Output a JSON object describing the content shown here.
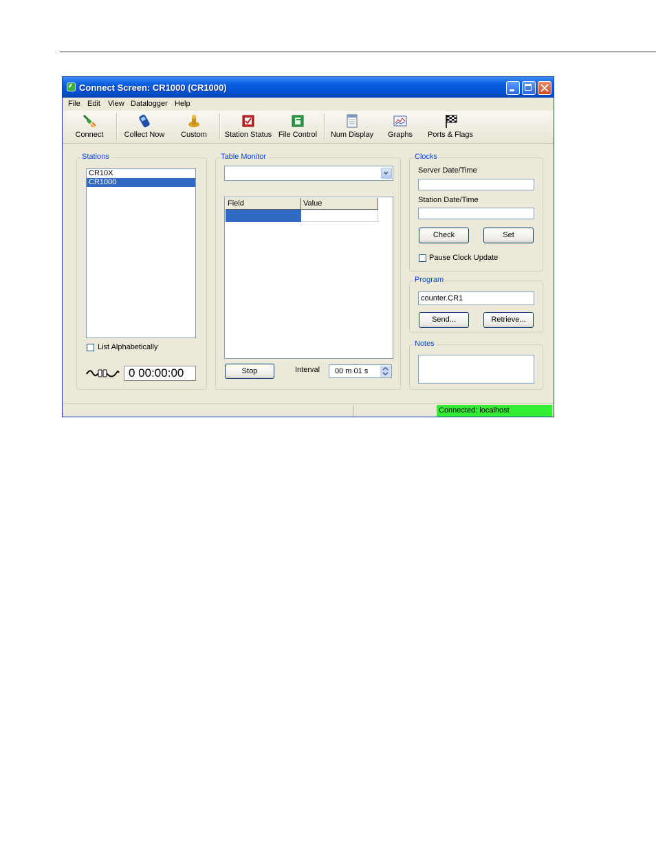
{
  "window": {
    "title": "Connect Screen: CR1000 (CR1000)"
  },
  "menu": [
    "File",
    "Edit",
    "View",
    "Datalogger",
    "Help"
  ],
  "toolbar": {
    "connect": "Connect",
    "collect_now": "Collect Now",
    "custom": "Custom",
    "station_status": "Station Status",
    "file_control": "File Control",
    "num_display": "Num Display",
    "graphs": "Graphs",
    "ports_flags": "Ports & Flags"
  },
  "stations": {
    "legend": "Stations",
    "items": [
      "CR10X",
      "CR1000"
    ],
    "selected": "CR1000",
    "list_alphabetically": "List Alphabetically",
    "timer": "0 00:00:00"
  },
  "table_monitor": {
    "legend": "Table Monitor",
    "dropdown_value": "",
    "columns": [
      "Field",
      "Value"
    ],
    "stop": "Stop",
    "interval_label": "Interval",
    "interval_value": "00 m 01 s"
  },
  "clocks": {
    "legend": "Clocks",
    "server_label": "Server Date/Time",
    "server_value": "",
    "station_label": "Station Date/Time",
    "station_value": "",
    "check": "Check",
    "set": "Set",
    "pause": "Pause Clock Update"
  },
  "program": {
    "legend": "Program",
    "file": "counter.CR1",
    "send": "Send...",
    "retrieve": "Retrieve..."
  },
  "notes": {
    "legend": "Notes",
    "value": ""
  },
  "status": {
    "connection": "Connected: localhost",
    "connection_color": "#33ee33"
  },
  "icons": [
    "app-icon",
    "connect-plug-icon",
    "collect-now-phone-icon",
    "custom-icon",
    "station-status-icon",
    "file-control-icon",
    "num-display-icon",
    "graphs-icon",
    "ports-flags-icon",
    "connection-cable-icon"
  ]
}
